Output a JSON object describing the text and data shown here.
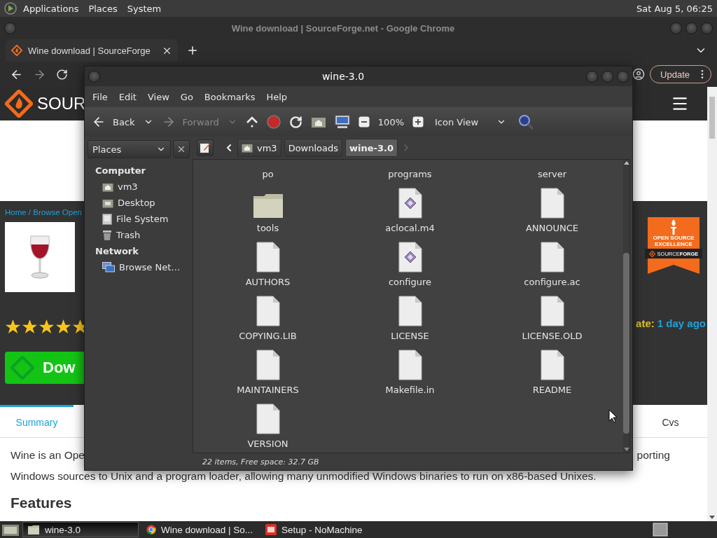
{
  "top_panel": {
    "menus": [
      "Applications",
      "Places",
      "System"
    ],
    "clock": "Sat Aug 5, 06:25"
  },
  "browser": {
    "title": "Wine download | SourceForge.net - Google Chrome",
    "tab": {
      "label": "Wine download | SourceForge"
    },
    "update_button": "Update",
    "page": {
      "logo": "SOUR",
      "breadcrumb": "Home / Browse Open",
      "stars": 5,
      "download_button": "Dow",
      "badge_title": "OPEN SOURCE EXCELLENCE",
      "badge_brand": "SOURCE**FORGE**",
      "updated_label": "ate:",
      "updated_value": "1 day ago",
      "tabs": [
        {
          "label": "Summary",
          "selected": true
        },
        {
          "label": "Cvs",
          "selected": false
        }
      ],
      "description_left": "Wine is an Ope",
      "description_right": "porting",
      "description_line2": "Windows sources to Unix and a program loader, allowing many unmodified Windows binaries to run on x86-based Unixes.",
      "features_heading": "Features"
    }
  },
  "file_manager": {
    "title": "wine-3.0",
    "menus": [
      "File",
      "Edit",
      "View",
      "Go",
      "Bookmarks",
      "Help"
    ],
    "toolbar": {
      "back": "Back",
      "forward": "Forward",
      "forward_disabled": true,
      "zoom": "100%",
      "view_mode": "Icon View"
    },
    "sidebar": {
      "selector": "Places",
      "sections": [
        {
          "heading": "Computer",
          "items": [
            {
              "label": "vm3",
              "kind": "home"
            },
            {
              "label": "Desktop",
              "kind": "desktop"
            },
            {
              "label": "File System",
              "kind": "drive"
            },
            {
              "label": "Trash",
              "kind": "trash"
            }
          ]
        },
        {
          "heading": "Network",
          "items": [
            {
              "label": "Browse Net…",
              "kind": "network"
            }
          ]
        }
      ]
    },
    "path": [
      {
        "label": "vm3",
        "kind": "home",
        "selected": false
      },
      {
        "label": "Downloads",
        "kind": "plain",
        "selected": false
      },
      {
        "label": "wine-3.0",
        "kind": "plain",
        "selected": true
      }
    ],
    "items": [
      {
        "label": "po",
        "kind": "clipped"
      },
      {
        "label": "programs",
        "kind": "clipped"
      },
      {
        "label": "server",
        "kind": "clipped"
      },
      {
        "label": "tools",
        "kind": "folder"
      },
      {
        "label": "aclocal.m4",
        "kind": "script"
      },
      {
        "label": "ANNOUNCE",
        "kind": "file"
      },
      {
        "label": "AUTHORS",
        "kind": "file"
      },
      {
        "label": "configure",
        "kind": "script"
      },
      {
        "label": "configure.ac",
        "kind": "file"
      },
      {
        "label": "COPYING.LIB",
        "kind": "file"
      },
      {
        "label": "LICENSE",
        "kind": "file"
      },
      {
        "label": "LICENSE.OLD",
        "kind": "file"
      },
      {
        "label": "MAINTAINERS",
        "kind": "file"
      },
      {
        "label": "Makefile.in",
        "kind": "file"
      },
      {
        "label": "README",
        "kind": "file"
      },
      {
        "label": "VERSION",
        "kind": "file"
      }
    ],
    "status": "22 items, Free space: 32.7 GB"
  },
  "taskbar": {
    "windows": [
      {
        "label": "wine-3.0",
        "kind": "folder",
        "selected": true
      },
      {
        "label": "Wine download | So...",
        "kind": "browser",
        "selected": false
      },
      {
        "label": "Setup - NoMachine",
        "kind": "app",
        "selected": false
      }
    ]
  }
}
